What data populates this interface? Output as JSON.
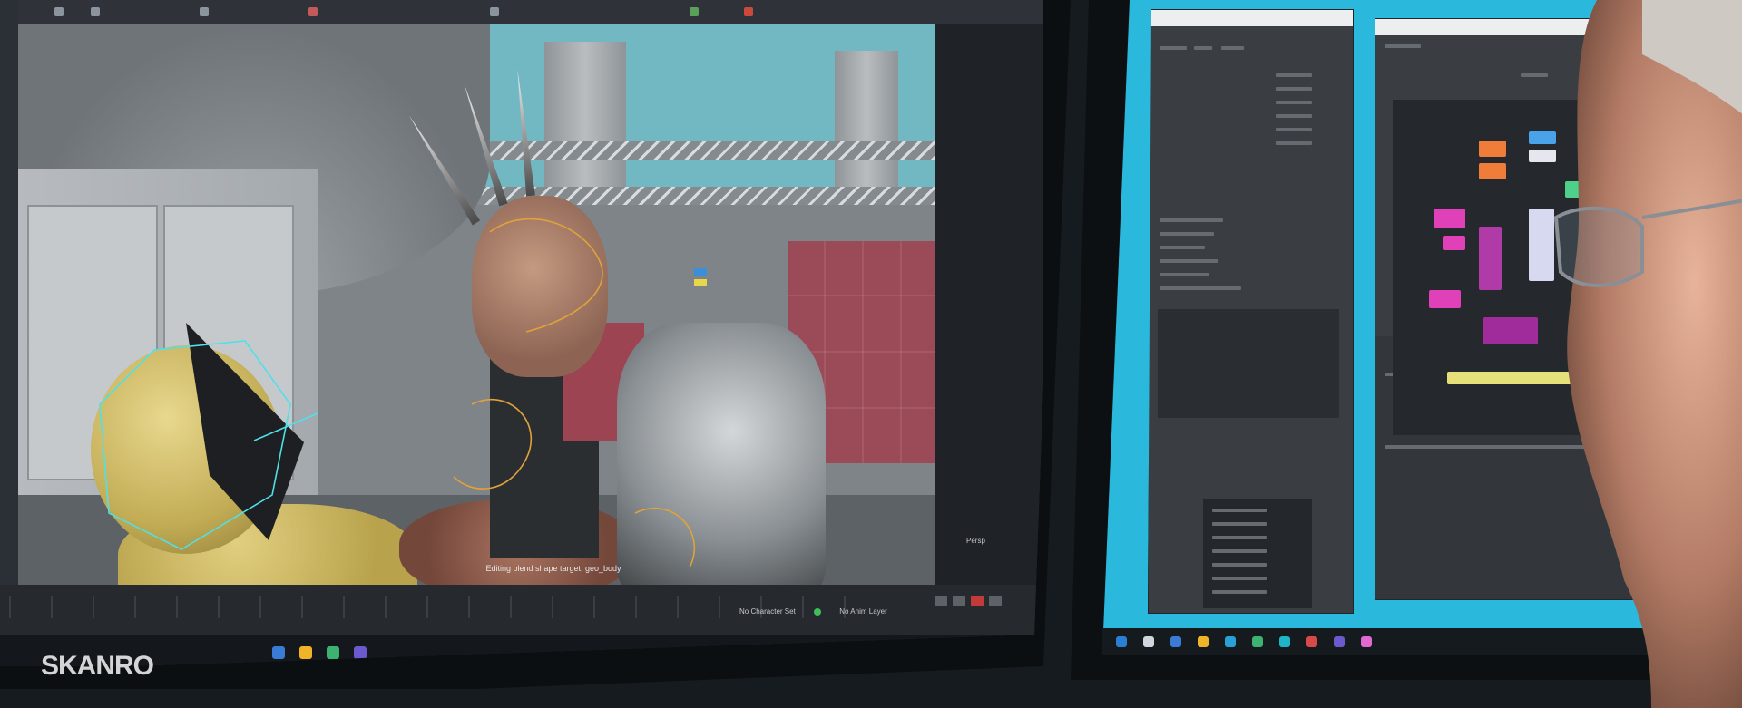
{
  "viewport": {
    "status_text": "Editing blend shape target: geo_body",
    "side_label": "Persp"
  },
  "timeline": {
    "labels": [
      "No Character Set",
      "No Anim Layer"
    ]
  },
  "watermark": {
    "text": "SKANRO"
  },
  "colors": {
    "right_desktop": "#2ab9dc",
    "accent_orange": "#f07c3a",
    "accent_magenta": "#e040b8",
    "accent_yellow": "#e6e07a",
    "rig_curve": "#e0a23a",
    "rig_control": "#4fe0e8"
  }
}
